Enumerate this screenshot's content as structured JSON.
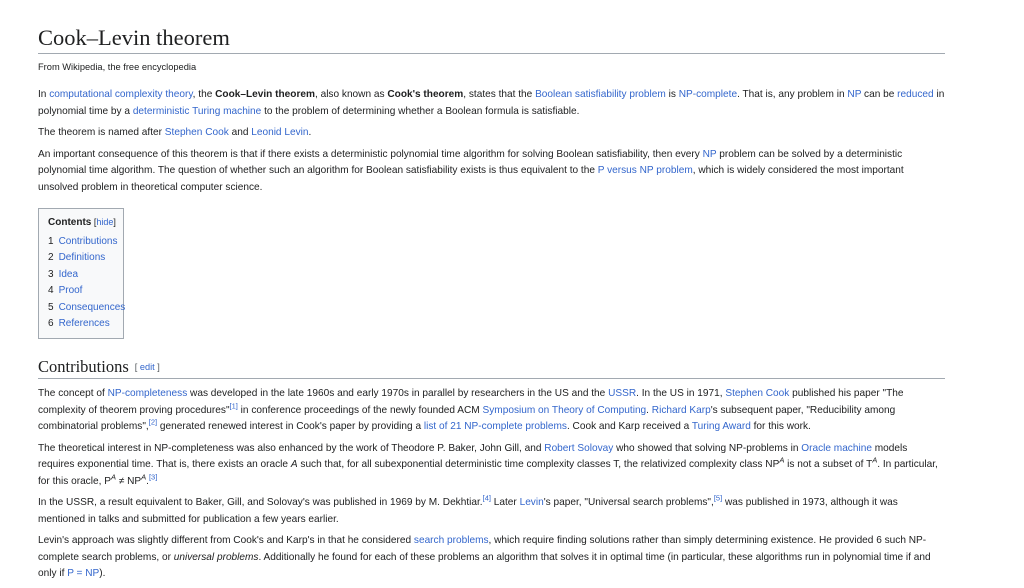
{
  "title": "Cook–Levin theorem",
  "tagline": "From Wikipedia, the free encyclopedia",
  "intro": {
    "p1": {
      "t1": "In ",
      "link_cct": "computational complexity theory",
      "t2": ", the ",
      "b1": "Cook–Levin theorem",
      "t3": ", also known as ",
      "b2": "Cook's theorem",
      "t4": ", states that the ",
      "link_bsat": "Boolean satisfiability problem",
      "t5": " is ",
      "link_npc": "NP-complete",
      "t6": ". That is, any problem in ",
      "link_np": "NP",
      "t7": " can be ",
      "link_reduced": "reduced",
      "t8": " in polynomial time by a ",
      "link_dtm": "deterministic Turing machine",
      "t9": " to the problem of determining whether a Boolean formula is satisfiable."
    },
    "p2": {
      "t1": "The theorem is named after ",
      "link_cook": "Stephen Cook",
      "t2": " and ",
      "link_levin": "Leonid Levin",
      "t3": "."
    },
    "p3": {
      "t1": "An important consequence of this theorem is that if there exists a deterministic polynomial time algorithm for solving Boolean satisfiability, then every ",
      "link_np": "NP",
      "t2": " problem can be solved by a deterministic polynomial time algorithm. The question of whether such an algorithm for Boolean satisfiability exists is thus equivalent to the ",
      "link_pvsnp": "P versus NP problem",
      "t3": ", which is widely considered the most important unsolved problem in theoretical computer science."
    }
  },
  "toc": {
    "title": "Contents",
    "hide_open": " [",
    "hide_label": "hide",
    "hide_close": "]",
    "items": [
      {
        "num": "1",
        "label": "Contributions"
      },
      {
        "num": "2",
        "label": "Definitions"
      },
      {
        "num": "3",
        "label": "Idea"
      },
      {
        "num": "4",
        "label": "Proof"
      },
      {
        "num": "5",
        "label": "Consequences"
      },
      {
        "num": "6",
        "label": "References"
      }
    ]
  },
  "contributions": {
    "heading": "Contributions",
    "edit_open": "[ ",
    "edit_label": "edit",
    "edit_close": " ]",
    "p1": {
      "t1": "The concept of ",
      "link_npcomp": "NP-completeness",
      "t2": " was developed in the late 1960s and early 1970s in parallel by researchers in the US and the ",
      "link_ussr": "USSR",
      "t3": ". In the US in 1971, ",
      "link_cook": "Stephen Cook",
      "t4": " published his paper \"The complexity of theorem proving procedures\"",
      "ref1": "[1]",
      "t5": " in conference proceedings of the newly founded ACM ",
      "link_stoc": "Symposium on Theory of Computing",
      "t6": ". ",
      "link_karp": "Richard Karp",
      "t7": "'s subsequent paper, \"Reducibility among combinatorial problems\",",
      "ref2": "[2]",
      "t8": " generated renewed interest in Cook's paper by providing a ",
      "link_list21": "list of 21 NP-complete problems",
      "t9": ". Cook and Karp received a ",
      "link_turing": "Turing Award",
      "t10": " for this work."
    },
    "p2": {
      "t1": "The theoretical interest in NP-completeness was also enhanced by the work of Theodore P. Baker, John Gill, and ",
      "link_solovay": "Robert Solovay",
      "t2": " who showed that solving NP-problems in ",
      "link_oracle": "Oracle machine",
      "t3": " models requires exponential time. That is, there exists an oracle ",
      "i_a": "A",
      "t4": " such that, for all subexponential deterministic time complexity classes T, the relativized complexity class NP",
      "sup_a1": "A",
      "t5": " is not a subset of T",
      "sup_a2": "A",
      "t6": ". In particular, for this oracle, P",
      "sup_a3": "A",
      "t7": " ≠ NP",
      "sup_a4": "A",
      "t8": ".",
      "ref3": "[3]"
    },
    "p3": {
      "t1": "In the USSR, a result equivalent to Baker, Gill, and Solovay's was published in 1969 by M. Dekhtiar.",
      "ref4": "[4]",
      "t2": " Later ",
      "link_levin": "Levin",
      "t3": "'s paper, \"Universal search problems\",",
      "ref5": "[5]",
      "t4": " was published in 1973, although it was mentioned in talks and submitted for publication a few years earlier."
    },
    "p4": {
      "t1": "Levin's approach was slightly different from Cook's and Karp's in that he considered ",
      "link_search": "search problems",
      "t2": ", which require finding solutions rather than simply determining existence. He provided 6 such NP-complete search problems, or ",
      "i_up": "universal problems",
      "t3": ". Additionally he found for each of these problems an algorithm that solves it in optimal time (in particular, these algorithms run in polynomial time if and only if ",
      "link_pnp": "P = NP",
      "t4": ")."
    }
  }
}
